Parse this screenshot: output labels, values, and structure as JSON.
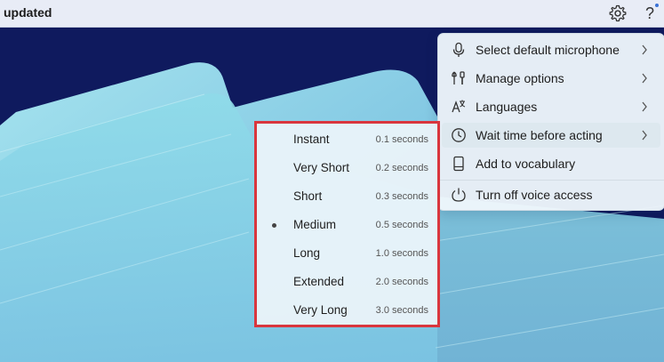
{
  "topbar": {
    "status": "updated",
    "settings_icon": "gear-icon",
    "help_label": "?"
  },
  "menu": {
    "items": [
      {
        "label": "Select default microphone",
        "icon": "microphone-icon",
        "submenu": true
      },
      {
        "label": "Manage options",
        "icon": "tools-icon",
        "submenu": true
      },
      {
        "label": "Languages",
        "icon": "language-icon",
        "submenu": true
      },
      {
        "label": "Wait time before acting",
        "icon": "clock-icon",
        "submenu": true,
        "highlighted": true
      },
      {
        "label": "Add to vocabulary",
        "icon": "notebook-icon",
        "submenu": false
      },
      {
        "label": "Turn off voice access",
        "icon": "power-icon",
        "submenu": false
      }
    ]
  },
  "submenu": {
    "selected": "Medium",
    "items": [
      {
        "label": "Instant",
        "value": "0.1 seconds"
      },
      {
        "label": "Very Short",
        "value": "0.2 seconds"
      },
      {
        "label": "Short",
        "value": "0.3 seconds"
      },
      {
        "label": "Medium",
        "value": "0.5 seconds"
      },
      {
        "label": "Long",
        "value": "1.0 seconds"
      },
      {
        "label": "Extended",
        "value": "2.0 seconds"
      },
      {
        "label": "Very Long",
        "value": "3.0 seconds"
      }
    ]
  },
  "colors": {
    "highlight_border": "#d9363e",
    "background_dark": "#0f1a5e",
    "background_light": "#8fd3e6"
  }
}
